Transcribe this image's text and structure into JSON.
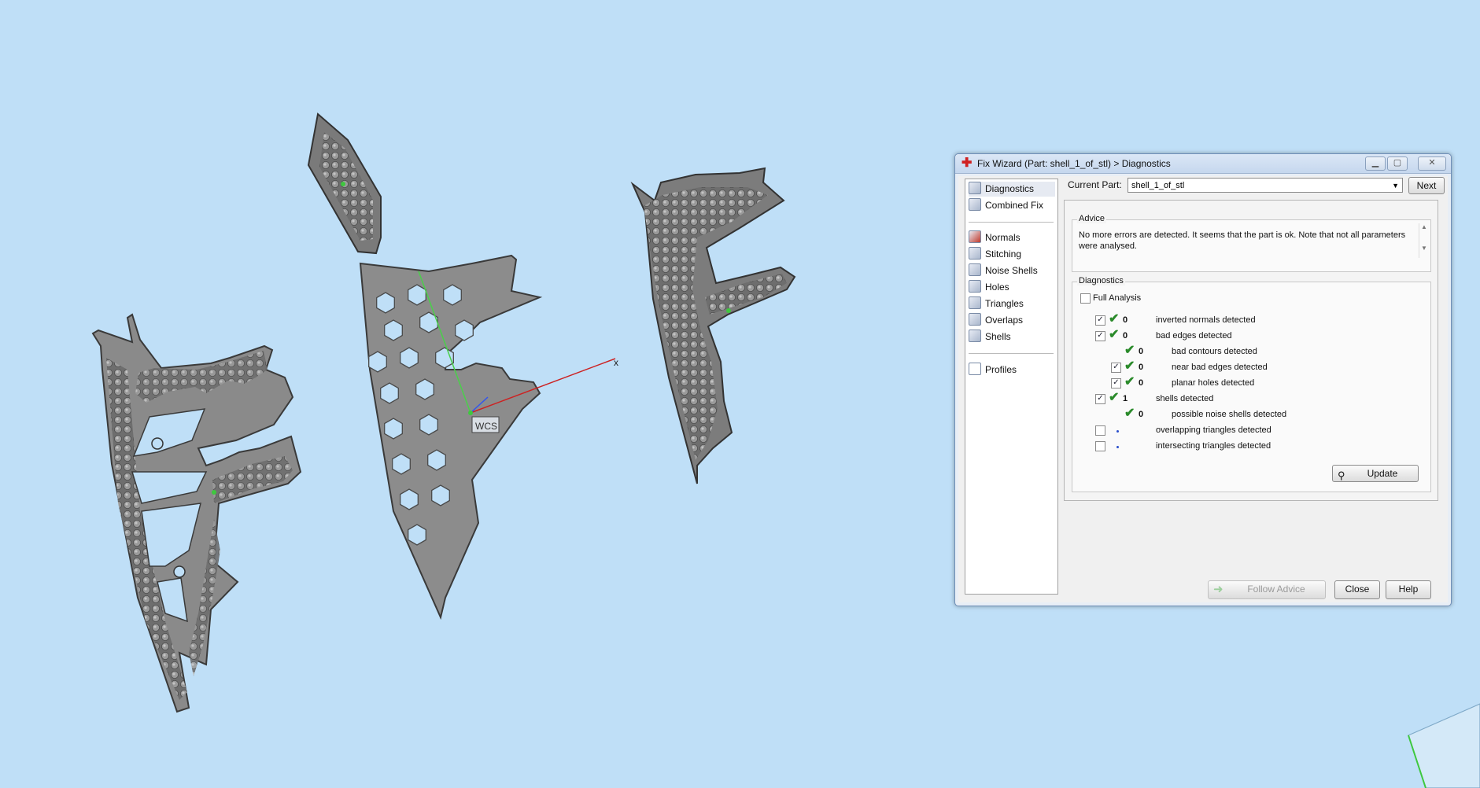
{
  "viewport": {
    "wcs_label": "WCS",
    "axis_x_label": "x"
  },
  "dialog": {
    "title": "Fix Wizard (Part: shell_1_of_stl) > Diagnostics",
    "nav": {
      "top": [
        "Diagnostics",
        "Combined Fix"
      ],
      "tools": [
        "Normals",
        "Stitching",
        "Noise Shells",
        "Holes",
        "Triangles",
        "Overlaps",
        "Shells"
      ],
      "bottom": [
        "Profiles"
      ]
    },
    "current_part_label": "Current Part:",
    "current_part_value": "shell_1_of_stl",
    "next_button": "Next",
    "advice_title": "Advice",
    "advice_text": "No more errors are detected. It seems that the part is ok. Note that not all parameters were analysed.",
    "diagnostics_title": "Diagnostics",
    "full_analysis_label": "Full Analysis",
    "rows": [
      {
        "checked": true,
        "status": "ok",
        "count": "0",
        "label": "inverted normals detected",
        "indent": 0
      },
      {
        "checked": true,
        "status": "ok",
        "count": "0",
        "label": "bad edges detected",
        "indent": 0
      },
      {
        "checked": null,
        "status": "ok",
        "count": "0",
        "label": "bad contours detected",
        "indent": 1
      },
      {
        "checked": true,
        "status": "ok",
        "count": "0",
        "label": "near bad edges detected",
        "indent": 1
      },
      {
        "checked": true,
        "status": "ok",
        "count": "0",
        "label": "planar holes detected",
        "indent": 1
      },
      {
        "checked": true,
        "status": "ok",
        "count": "1",
        "label": "shells detected",
        "indent": 0
      },
      {
        "checked": null,
        "status": "ok",
        "count": "0",
        "label": "possible noise shells detected",
        "indent": 1
      },
      {
        "checked": false,
        "status": "none",
        "count": "",
        "label": "overlapping triangles detected",
        "indent": 0
      },
      {
        "checked": false,
        "status": "none",
        "count": "",
        "label": "intersecting triangles detected",
        "indent": 0
      }
    ],
    "update_button": "Update",
    "follow_advice_button": "Follow Advice",
    "close_button": "Close",
    "help_button": "Help"
  }
}
